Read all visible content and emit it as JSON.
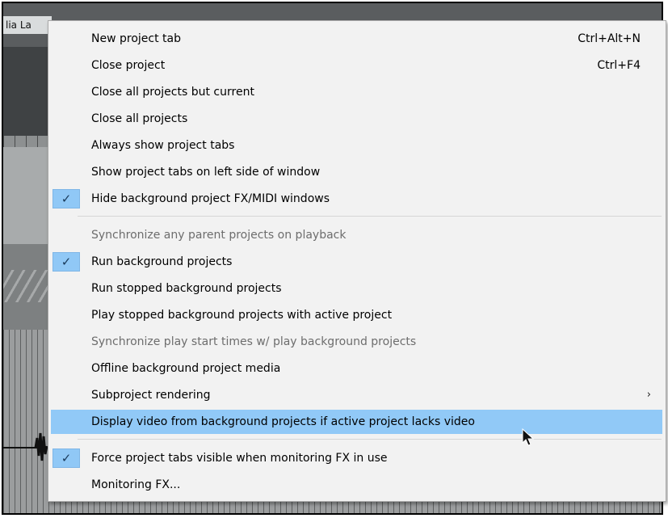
{
  "background": {
    "tab_label": "lia La"
  },
  "menu": {
    "items": [
      {
        "label": "New project tab",
        "shortcut": "Ctrl+Alt+N",
        "checked": false,
        "disabled": false,
        "highlighted": false,
        "submenu": false
      },
      {
        "label": "Close project",
        "shortcut": "Ctrl+F4",
        "checked": false,
        "disabled": false,
        "highlighted": false,
        "submenu": false
      },
      {
        "label": "Close all projects but current",
        "shortcut": "",
        "checked": false,
        "disabled": false,
        "highlighted": false,
        "submenu": false
      },
      {
        "label": "Close all projects",
        "shortcut": "",
        "checked": false,
        "disabled": false,
        "highlighted": false,
        "submenu": false
      },
      {
        "label": "Always show project tabs",
        "shortcut": "",
        "checked": false,
        "disabled": false,
        "highlighted": false,
        "submenu": false
      },
      {
        "label": "Show project tabs on left side of window",
        "shortcut": "",
        "checked": false,
        "disabled": false,
        "highlighted": false,
        "submenu": false
      },
      {
        "label": "Hide background project FX/MIDI windows",
        "shortcut": "",
        "checked": true,
        "disabled": false,
        "highlighted": false,
        "submenu": false
      },
      {
        "label": "Synchronize any parent projects on playback",
        "shortcut": "",
        "checked": false,
        "disabled": true,
        "highlighted": false,
        "submenu": false
      },
      {
        "label": "Run background projects",
        "shortcut": "",
        "checked": true,
        "disabled": false,
        "highlighted": false,
        "submenu": false
      },
      {
        "label": "Run stopped background projects",
        "shortcut": "",
        "checked": false,
        "disabled": false,
        "highlighted": false,
        "submenu": false
      },
      {
        "label": "Play stopped background projects with active project",
        "shortcut": "",
        "checked": false,
        "disabled": false,
        "highlighted": false,
        "submenu": false
      },
      {
        "label": "Synchronize play start times w/ play background projects",
        "shortcut": "",
        "checked": false,
        "disabled": true,
        "highlighted": false,
        "submenu": false
      },
      {
        "label": "Offline background project media",
        "shortcut": "",
        "checked": false,
        "disabled": false,
        "highlighted": false,
        "submenu": false
      },
      {
        "label": "Subproject rendering",
        "shortcut": "",
        "checked": false,
        "disabled": false,
        "highlighted": false,
        "submenu": true
      },
      {
        "label": "Display video from background projects if active project lacks video",
        "shortcut": "",
        "checked": false,
        "disabled": false,
        "highlighted": true,
        "submenu": false
      },
      {
        "label": "Force project tabs visible when monitoring FX in use",
        "shortcut": "",
        "checked": true,
        "disabled": false,
        "highlighted": false,
        "submenu": false
      },
      {
        "label": "Monitoring FX...",
        "shortcut": "",
        "checked": false,
        "disabled": false,
        "highlighted": false,
        "submenu": false
      }
    ],
    "check_glyph": "✓",
    "submenu_glyph": "›",
    "highlight_color": "#91c9f7"
  }
}
